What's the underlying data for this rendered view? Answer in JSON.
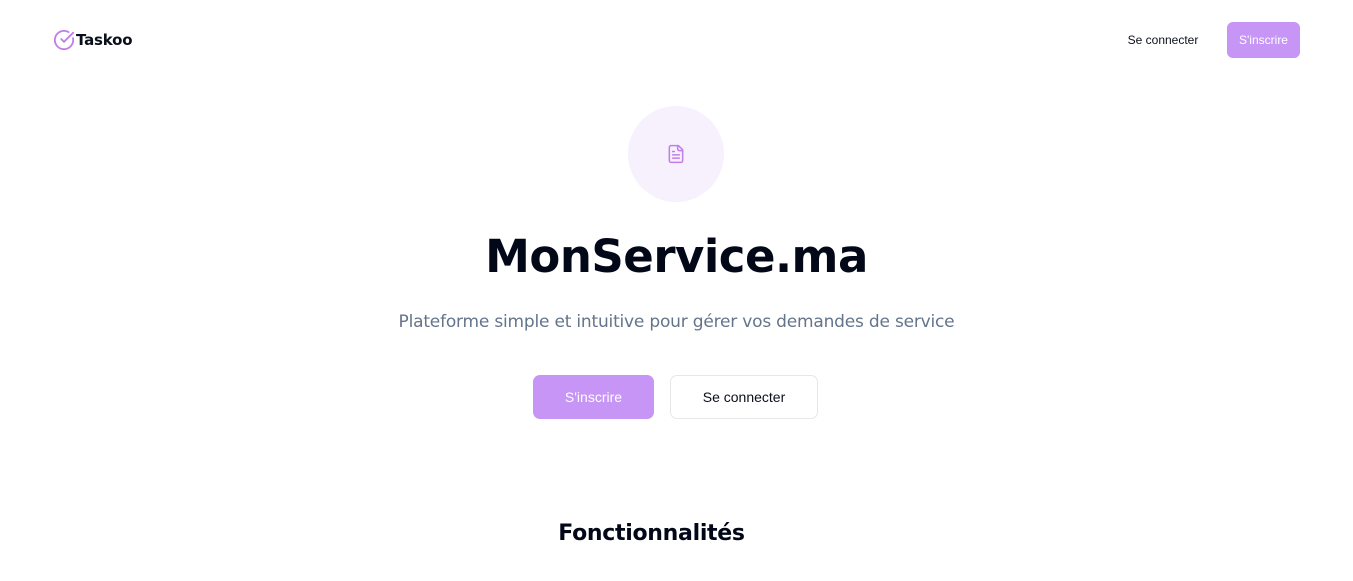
{
  "header": {
    "brand_name": "Taskoo",
    "login_label": "Se connecter",
    "signup_label": "S'inscrire"
  },
  "hero": {
    "icon": "file-text-icon",
    "title": "MonService.ma",
    "subtitle": "Plateforme simple et intuitive pour gérer vos demandes de service",
    "signup_label": "S'inscrire",
    "login_label": "Se connecter"
  },
  "features": {
    "title": "Fonctionnalités"
  },
  "colors": {
    "accent": "#c695f5",
    "icon_stroke": "#c27fe8",
    "icon_circle_bg": "#f7f0fd",
    "title_text": "#020817",
    "muted_text": "#64748b"
  }
}
